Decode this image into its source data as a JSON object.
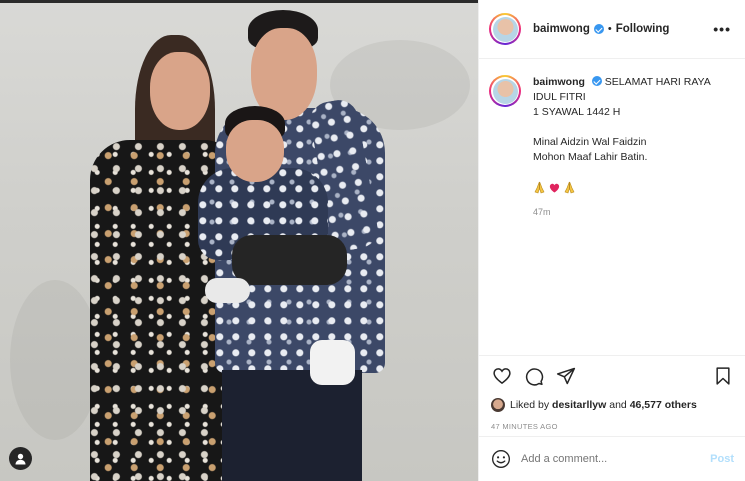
{
  "post": {
    "username": "baimwong",
    "follow_status": "Following",
    "more_label": "•••",
    "separator": "•"
  },
  "caption": {
    "username": "baimwong",
    "line1": "SELAMAT HARI RAYA IDUL FITRI",
    "line2": "1 SYAWAL 1442 H",
    "line3": "Minal Aidzin Wal Faidzin",
    "line4": "Mohon Maaf Lahir Batin.",
    "emojis": [
      "🙏",
      "❤",
      "🙏"
    ],
    "time": "47m"
  },
  "likes": {
    "prefix": "Liked by",
    "user": "desitarllyw",
    "and": "and",
    "count": "46,577 others"
  },
  "post_time": "47 MINUTES AGO",
  "comment": {
    "placeholder": "Add a comment...",
    "post_label": "Post"
  },
  "icons": {
    "like": "heart-icon",
    "comment": "comment-icon",
    "share": "paper-plane-icon",
    "save": "bookmark-icon",
    "emoji": "emoji-icon",
    "corner": "user-tag-icon"
  },
  "colors": {
    "verified": "#3897f0",
    "post_button": "#b2dffc",
    "muted": "#8e8e8e",
    "text": "#262626"
  }
}
